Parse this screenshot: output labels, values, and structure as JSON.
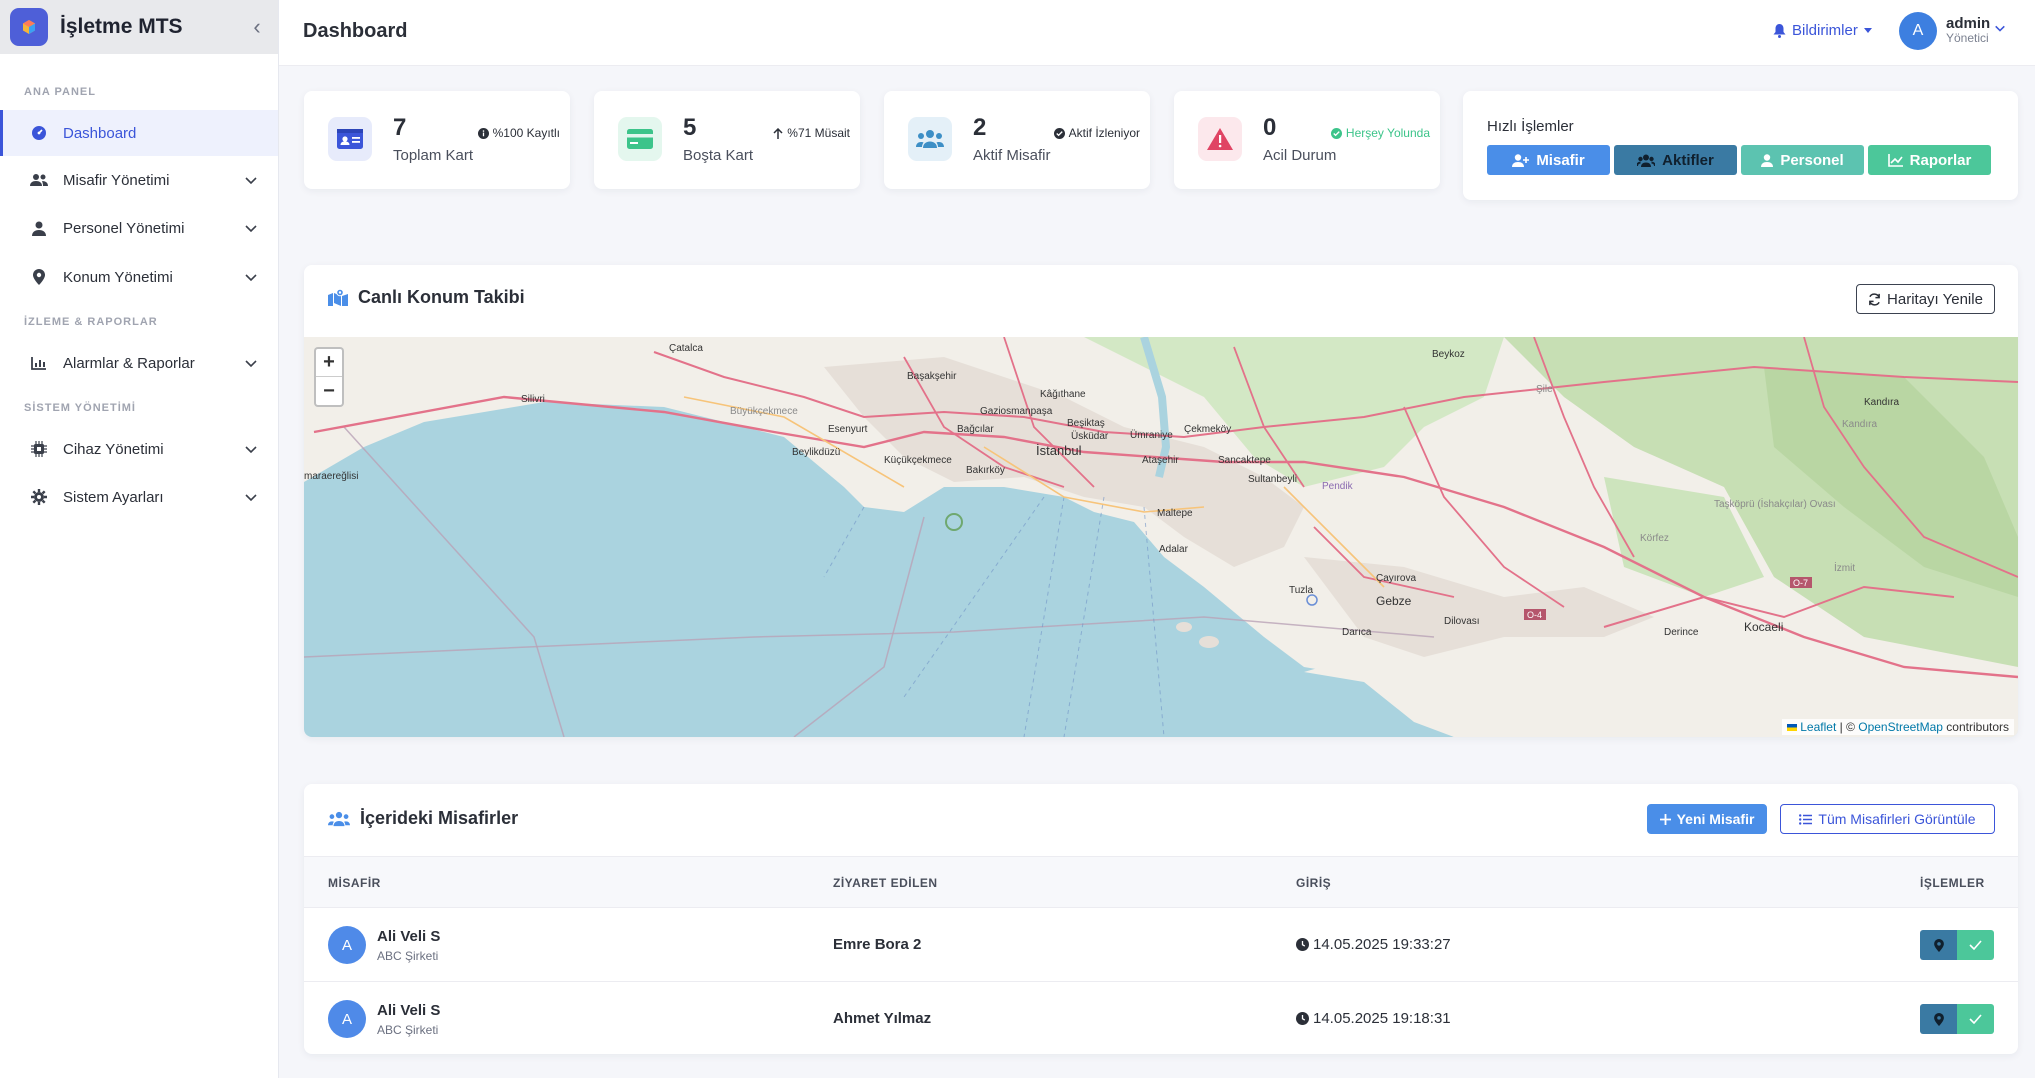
{
  "sidebar": {
    "brand": "İşletme MTS",
    "sections": [
      "ANA PANEL",
      "İZLEME & RAPORLAR",
      "SİSTEM YÖNETİMİ"
    ],
    "items": [
      {
        "label": "Dashboard",
        "icon": "gauge-icon",
        "active": true
      },
      {
        "label": "Misafir Yönetimi",
        "icon": "users-icon"
      },
      {
        "label": "Personel Yönetimi",
        "icon": "user-icon"
      },
      {
        "label": "Konum Yönetimi",
        "icon": "map-pin-icon"
      },
      {
        "label": "Alarmlar & Raporlar",
        "icon": "chart-icon"
      },
      {
        "label": "Cihaz Yönetimi",
        "icon": "chip-icon"
      },
      {
        "label": "Sistem Ayarları",
        "icon": "gear-icon"
      }
    ]
  },
  "header": {
    "title": "Dashboard",
    "notifications_label": "Bildirimler",
    "user": {
      "initial": "A",
      "name": "admin",
      "role": "Yönetici"
    }
  },
  "stats": [
    {
      "value": "7",
      "label": "Toplam Kart",
      "badge": "%100 Kayıtlı",
      "color": "#3b55d9",
      "bg": "#e7ebfb",
      "icon": "id-card-icon"
    },
    {
      "value": "5",
      "label": "Boşta Kart",
      "badge": "%71 Müsait",
      "color": "#3cc48a",
      "bg": "#e4f7ee",
      "icon": "credit-card-icon"
    },
    {
      "value": "2",
      "label": "Aktif Misafir",
      "badge": "Aktif İzleniyor",
      "color": "#3d8fc6",
      "bg": "#e4f0f8",
      "icon": "users-icon"
    },
    {
      "value": "0",
      "label": "Acil Durum",
      "badge": "Herşey Yolunda",
      "color": "#e04464",
      "bg": "#fce8ec",
      "icon": "warning-icon"
    }
  ],
  "quick_actions": {
    "title": "Hızlı İşlemler",
    "buttons": [
      {
        "label": "Misafir",
        "color": "#4a8ee8"
      },
      {
        "label": "Aktifler",
        "color": "#3a7aa3"
      },
      {
        "label": "Personel",
        "color": "#5cc3b0"
      },
      {
        "label": "Raporlar",
        "color": "#4cc79a"
      }
    ]
  },
  "map_panel": {
    "title": "Canlı Konum Takibi",
    "refresh_label": "Haritayı Yenile",
    "zoom_in": "+",
    "zoom_out": "−",
    "attribution_leaflet": "Leaflet",
    "attribution_sep": " | © ",
    "attribution_osm": "OpenStreetMap",
    "attribution_tail": " contributors",
    "places": [
      "Beykoz",
      "Çatalca",
      "Başakşehir",
      "Kâğıthane",
      "Gaziosmanpaşa",
      "Silivri",
      "Büyükçekmece",
      "Esenyurt",
      "Bağcılar",
      "Beşiktaş",
      "Ümraniye",
      "Çekmeköy",
      "Şile",
      "Kandıra",
      "Üsküdar",
      "İstanbul",
      "Beylikdüzü",
      "Küçükçekmece",
      "Bakırköy",
      "Ataşehir",
      "Sancaktepe",
      "Sultanbeyli",
      "Pendik",
      "Maltepe",
      "Adalar",
      "Gebze",
      "Çayırova",
      "Tuzla",
      "Darıca",
      "Dilovası",
      "Derince",
      "Kocaeli",
      "Körfez",
      "İzmit",
      "Kandıra",
      "Taşköprü (İshakçılar) Ovası",
      "maraereğlisi"
    ],
    "roads": [
      "O-4",
      "O-7"
    ]
  },
  "guests_panel": {
    "title": "İçerideki Misafirler",
    "new_label": "Yeni Misafir",
    "all_label": "Tüm Misafirleri Görüntüle",
    "columns": [
      "MİSAFİR",
      "ZİYARET EDİLEN",
      "GİRİŞ",
      "İŞLEMLER"
    ],
    "rows": [
      {
        "initial": "A",
        "name": "Ali Veli S",
        "company": "ABC Şirketi",
        "visited": "Emre Bora 2",
        "entry": "14.05.2025 19:33:27"
      },
      {
        "initial": "A",
        "name": "Ali Veli S",
        "company": "ABC Şirketi",
        "visited": "Ahmet Yılmaz",
        "entry": "14.05.2025 19:18:31"
      }
    ]
  }
}
